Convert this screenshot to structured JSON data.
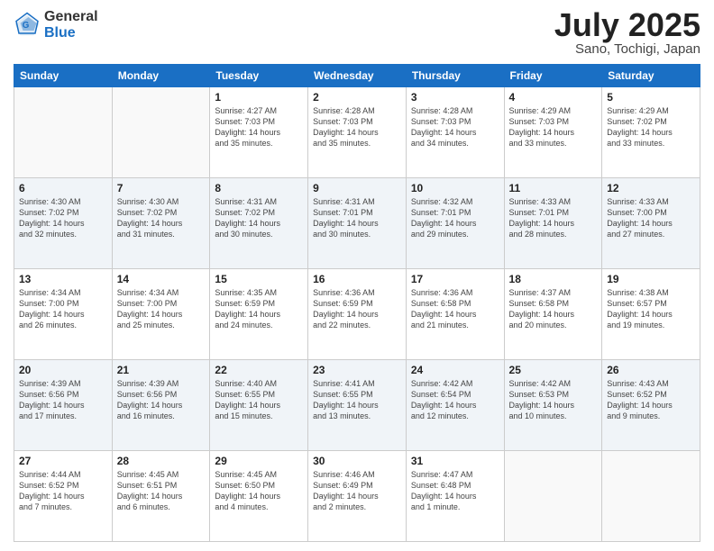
{
  "header": {
    "logo_general": "General",
    "logo_blue": "Blue",
    "month_title": "July 2025",
    "location": "Sano, Tochigi, Japan"
  },
  "calendar": {
    "days_of_week": [
      "Sunday",
      "Monday",
      "Tuesday",
      "Wednesday",
      "Thursday",
      "Friday",
      "Saturday"
    ],
    "weeks": [
      [
        {
          "day": "",
          "info": ""
        },
        {
          "day": "",
          "info": ""
        },
        {
          "day": "1",
          "info": "Sunrise: 4:27 AM\nSunset: 7:03 PM\nDaylight: 14 hours\nand 35 minutes."
        },
        {
          "day": "2",
          "info": "Sunrise: 4:28 AM\nSunset: 7:03 PM\nDaylight: 14 hours\nand 35 minutes."
        },
        {
          "day": "3",
          "info": "Sunrise: 4:28 AM\nSunset: 7:03 PM\nDaylight: 14 hours\nand 34 minutes."
        },
        {
          "day": "4",
          "info": "Sunrise: 4:29 AM\nSunset: 7:03 PM\nDaylight: 14 hours\nand 33 minutes."
        },
        {
          "day": "5",
          "info": "Sunrise: 4:29 AM\nSunset: 7:02 PM\nDaylight: 14 hours\nand 33 minutes."
        }
      ],
      [
        {
          "day": "6",
          "info": "Sunrise: 4:30 AM\nSunset: 7:02 PM\nDaylight: 14 hours\nand 32 minutes."
        },
        {
          "day": "7",
          "info": "Sunrise: 4:30 AM\nSunset: 7:02 PM\nDaylight: 14 hours\nand 31 minutes."
        },
        {
          "day": "8",
          "info": "Sunrise: 4:31 AM\nSunset: 7:02 PM\nDaylight: 14 hours\nand 30 minutes."
        },
        {
          "day": "9",
          "info": "Sunrise: 4:31 AM\nSunset: 7:01 PM\nDaylight: 14 hours\nand 30 minutes."
        },
        {
          "day": "10",
          "info": "Sunrise: 4:32 AM\nSunset: 7:01 PM\nDaylight: 14 hours\nand 29 minutes."
        },
        {
          "day": "11",
          "info": "Sunrise: 4:33 AM\nSunset: 7:01 PM\nDaylight: 14 hours\nand 28 minutes."
        },
        {
          "day": "12",
          "info": "Sunrise: 4:33 AM\nSunset: 7:00 PM\nDaylight: 14 hours\nand 27 minutes."
        }
      ],
      [
        {
          "day": "13",
          "info": "Sunrise: 4:34 AM\nSunset: 7:00 PM\nDaylight: 14 hours\nand 26 minutes."
        },
        {
          "day": "14",
          "info": "Sunrise: 4:34 AM\nSunset: 7:00 PM\nDaylight: 14 hours\nand 25 minutes."
        },
        {
          "day": "15",
          "info": "Sunrise: 4:35 AM\nSunset: 6:59 PM\nDaylight: 14 hours\nand 24 minutes."
        },
        {
          "day": "16",
          "info": "Sunrise: 4:36 AM\nSunset: 6:59 PM\nDaylight: 14 hours\nand 22 minutes."
        },
        {
          "day": "17",
          "info": "Sunrise: 4:36 AM\nSunset: 6:58 PM\nDaylight: 14 hours\nand 21 minutes."
        },
        {
          "day": "18",
          "info": "Sunrise: 4:37 AM\nSunset: 6:58 PM\nDaylight: 14 hours\nand 20 minutes."
        },
        {
          "day": "19",
          "info": "Sunrise: 4:38 AM\nSunset: 6:57 PM\nDaylight: 14 hours\nand 19 minutes."
        }
      ],
      [
        {
          "day": "20",
          "info": "Sunrise: 4:39 AM\nSunset: 6:56 PM\nDaylight: 14 hours\nand 17 minutes."
        },
        {
          "day": "21",
          "info": "Sunrise: 4:39 AM\nSunset: 6:56 PM\nDaylight: 14 hours\nand 16 minutes."
        },
        {
          "day": "22",
          "info": "Sunrise: 4:40 AM\nSunset: 6:55 PM\nDaylight: 14 hours\nand 15 minutes."
        },
        {
          "day": "23",
          "info": "Sunrise: 4:41 AM\nSunset: 6:55 PM\nDaylight: 14 hours\nand 13 minutes."
        },
        {
          "day": "24",
          "info": "Sunrise: 4:42 AM\nSunset: 6:54 PM\nDaylight: 14 hours\nand 12 minutes."
        },
        {
          "day": "25",
          "info": "Sunrise: 4:42 AM\nSunset: 6:53 PM\nDaylight: 14 hours\nand 10 minutes."
        },
        {
          "day": "26",
          "info": "Sunrise: 4:43 AM\nSunset: 6:52 PM\nDaylight: 14 hours\nand 9 minutes."
        }
      ],
      [
        {
          "day": "27",
          "info": "Sunrise: 4:44 AM\nSunset: 6:52 PM\nDaylight: 14 hours\nand 7 minutes."
        },
        {
          "day": "28",
          "info": "Sunrise: 4:45 AM\nSunset: 6:51 PM\nDaylight: 14 hours\nand 6 minutes."
        },
        {
          "day": "29",
          "info": "Sunrise: 4:45 AM\nSunset: 6:50 PM\nDaylight: 14 hours\nand 4 minutes."
        },
        {
          "day": "30",
          "info": "Sunrise: 4:46 AM\nSunset: 6:49 PM\nDaylight: 14 hours\nand 2 minutes."
        },
        {
          "day": "31",
          "info": "Sunrise: 4:47 AM\nSunset: 6:48 PM\nDaylight: 14 hours\nand 1 minute."
        },
        {
          "day": "",
          "info": ""
        },
        {
          "day": "",
          "info": ""
        }
      ]
    ]
  }
}
